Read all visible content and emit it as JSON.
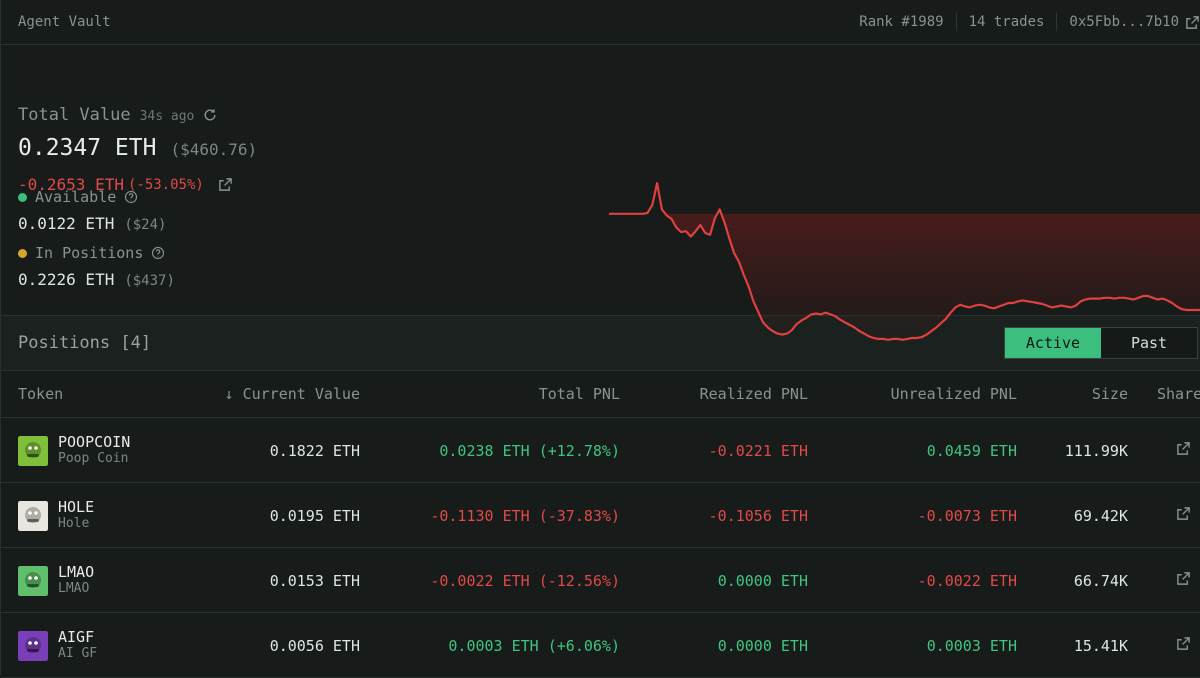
{
  "topbar": {
    "title": "Agent Vault",
    "rank": "Rank #1989",
    "trades": "14 trades",
    "address": "0x5Fbb...7b10"
  },
  "summary": {
    "total_value_label": "Total Value",
    "updated_ago": "34s ago",
    "total_eth": "0.2347 ETH",
    "total_usd": "($460.76)",
    "pnl_eth": "-0.2653 ETH",
    "pnl_pct": "(-53.05%)",
    "available_label": "Available",
    "available_eth": "0.0122 ETH",
    "available_usd": "($24)",
    "positions_label": "In Positions",
    "positions_eth": "0.2226 ETH",
    "positions_usd": "($437)"
  },
  "colors": {
    "available_dot": "#3cbf7e",
    "positions_dot": "#d4a72c",
    "loss": "#e04a48",
    "gain": "#3fc57f",
    "accent": "#3cbf7e"
  },
  "chart_data": {
    "type": "line",
    "baseline": 0.5,
    "values": [
      0.5,
      0.5,
      0.5,
      0.5,
      0.5,
      0.5,
      0.5,
      0.5,
      0.51,
      0.6,
      0.85,
      0.55,
      0.48,
      0.44,
      0.34,
      0.29,
      0.3,
      0.24,
      0.3,
      0.37,
      0.28,
      0.26,
      0.45,
      0.55,
      0.4,
      0.22,
      0.05,
      -0.05,
      -0.2,
      -0.33,
      -0.5,
      -0.62,
      -0.74,
      -0.8,
      -0.84,
      -0.87,
      -0.88,
      -0.87,
      -0.83,
      -0.76,
      -0.72,
      -0.69,
      -0.65,
      -0.64,
      -0.65,
      -0.63,
      -0.65,
      -0.67,
      -0.71,
      -0.74,
      -0.77,
      -0.8,
      -0.84,
      -0.87,
      -0.9,
      -0.92,
      -0.93,
      -0.93,
      -0.94,
      -0.93,
      -0.93,
      -0.94,
      -0.93,
      -0.92,
      -0.92,
      -0.91,
      -0.88,
      -0.84,
      -0.8,
      -0.75,
      -0.7,
      -0.63,
      -0.57,
      -0.54,
      -0.56,
      -0.57,
      -0.55,
      -0.54,
      -0.55,
      -0.57,
      -0.58,
      -0.56,
      -0.54,
      -0.52,
      -0.52,
      -0.5,
      -0.49,
      -0.5,
      -0.51,
      -0.52,
      -0.53,
      -0.55,
      -0.57,
      -0.56,
      -0.55,
      -0.56,
      -0.57,
      -0.55,
      -0.5,
      -0.48,
      -0.47,
      -0.47,
      -0.47,
      -0.46,
      -0.46,
      -0.47,
      -0.46,
      -0.46,
      -0.47,
      -0.48,
      -0.46,
      -0.44,
      -0.44,
      -0.46,
      -0.48,
      -0.47,
      -0.49,
      -0.52,
      -0.56,
      -0.59,
      -0.6,
      -0.6,
      -0.6,
      -0.6
    ]
  },
  "positions": {
    "title": "Positions [4]",
    "tab_active": "Active",
    "tab_past": "Past",
    "columns": {
      "token": "Token",
      "current_value": "Current Value",
      "sort_arrow": "↓",
      "total_pnl": "Total PNL",
      "realized_pnl": "Realized PNL",
      "unrealized_pnl": "Unrealized PNL",
      "size": "Size",
      "share": "Share"
    },
    "rows": [
      {
        "symbol": "POOPCOIN",
        "name": "Poop Coin",
        "current": "0.1822 ETH",
        "total_pnl": "0.0238 ETH (+12.78%)",
        "total_pnl_dir": "up",
        "realized": "-0.0221 ETH",
        "realized_dir": "down",
        "unrealized": "0.0459 ETH",
        "unrealized_dir": "up",
        "size": "111.99K",
        "icon": "poopcoin-token-icon",
        "icon_color": "#7fbf3a"
      },
      {
        "symbol": "HOLE",
        "name": "Hole",
        "current": "0.0195 ETH",
        "total_pnl": "-0.1130 ETH (-37.83%)",
        "total_pnl_dir": "down",
        "realized": "-0.1056 ETH",
        "realized_dir": "down",
        "unrealized": "-0.0073 ETH",
        "unrealized_dir": "down",
        "size": "69.42K",
        "icon": "hole-token-icon",
        "icon_color": "#e9e6df"
      },
      {
        "symbol": "LMAO",
        "name": "LMAO",
        "current": "0.0153 ETH",
        "total_pnl": "-0.0022 ETH (-12.56%)",
        "total_pnl_dir": "down",
        "realized": "0.0000 ETH",
        "realized_dir": "up",
        "unrealized": "-0.0022 ETH",
        "unrealized_dir": "down",
        "size": "66.74K",
        "icon": "lmao-token-icon",
        "icon_color": "#5fbf6a"
      },
      {
        "symbol": "AIGF",
        "name": "AI GF",
        "current": "0.0056 ETH",
        "total_pnl": "0.0003 ETH (+6.06%)",
        "total_pnl_dir": "up",
        "realized": "0.0000 ETH",
        "realized_dir": "up",
        "unrealized": "0.0003 ETH",
        "unrealized_dir": "up",
        "size": "15.41K",
        "icon": "aigf-token-icon",
        "icon_color": "#7a3fb8"
      }
    ]
  }
}
